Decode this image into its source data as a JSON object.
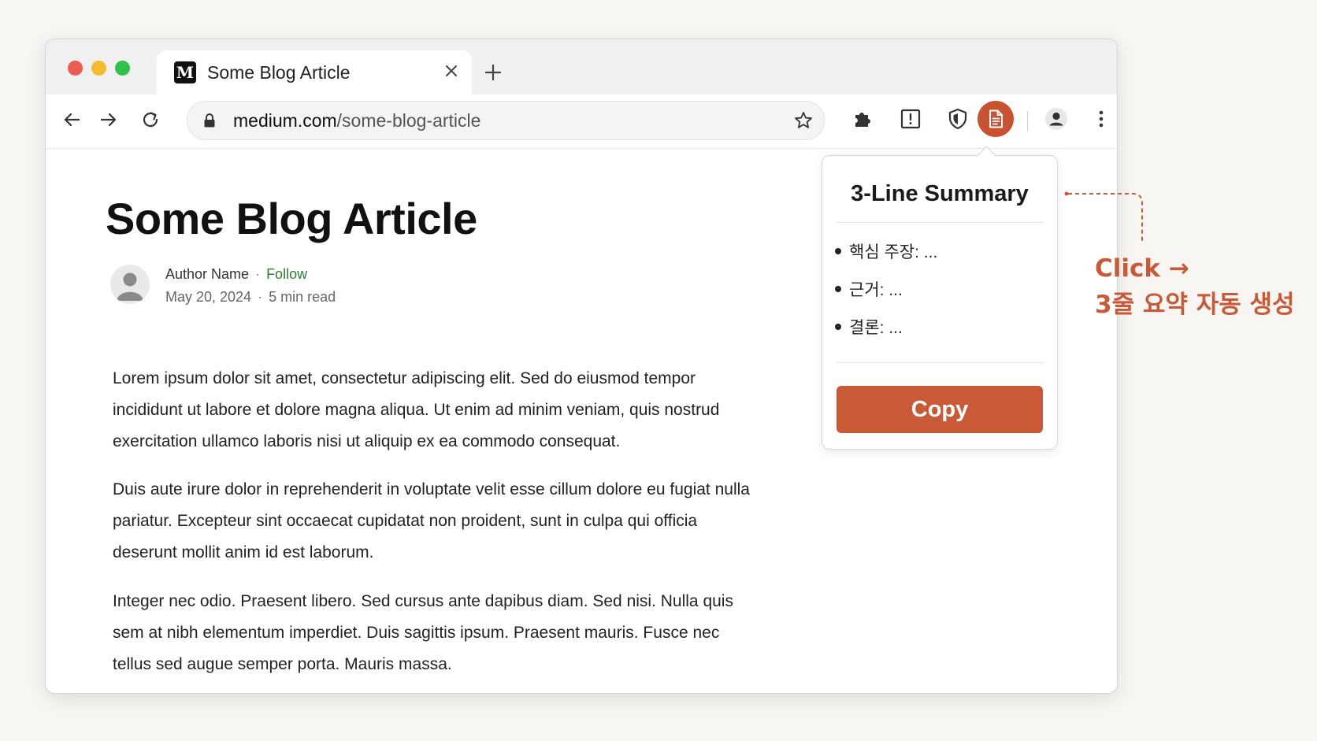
{
  "tab": {
    "favicon": "M",
    "title": "Some Blog Article"
  },
  "address_bar": {
    "domain": "medium.com",
    "path": "/some-blog-article"
  },
  "toolbar_icons": [
    "back-icon",
    "forward-icon",
    "reload-icon",
    "lock-icon",
    "bookmark-star-icon",
    "puzzle-extensions-icon",
    "reader-mode-icon",
    "shield-icon",
    "summary-document-icon",
    "profile-icon",
    "more-menu-icon"
  ],
  "article": {
    "title": "Some Blog Article",
    "author": "Author Name",
    "follow": "Follow",
    "separator": "·",
    "date": "May 20, 2024",
    "read_time": "5 min read",
    "paragraphs": [
      "Lorem ipsum dolor sit amet, consectetur adipiscing elit. Sed do eiusmod tempor incididunt ut labore et dolore magna aliqua. Ut enim ad minim veniam, quis nostrud exercitation ullamco laboris nisi ut aliquip ex ea commodo consequat.",
      "Duis aute irure dolor in reprehenderit in voluptate velit esse cillum dolore eu fugiat nulla pariatur. Excepteur sint occaecat cupidatat non proident, sunt in culpa qui officia deserunt mollit anim id est laborum.",
      "Integer nec odio. Praesent libero. Sed cursus ante dapibus diam. Sed nisi. Nulla quis sem at nibh elementum imperdiet. Duis sagittis ipsum. Praesent mauris. Fusce nec tellus sed augue semper porta. Mauris massa."
    ]
  },
  "popup": {
    "title": "3-Line Summary",
    "bullets": [
      "핵심 주장: ...",
      "근거: ...",
      "결론: ..."
    ],
    "copy_label": "Copy"
  },
  "callout": {
    "line1": "Click →",
    "line2": "3줄 요약 자동 생성"
  },
  "colors": {
    "accent": "#c85a37",
    "follow_green": "#2e7d32",
    "background": "#f8f6f2"
  }
}
